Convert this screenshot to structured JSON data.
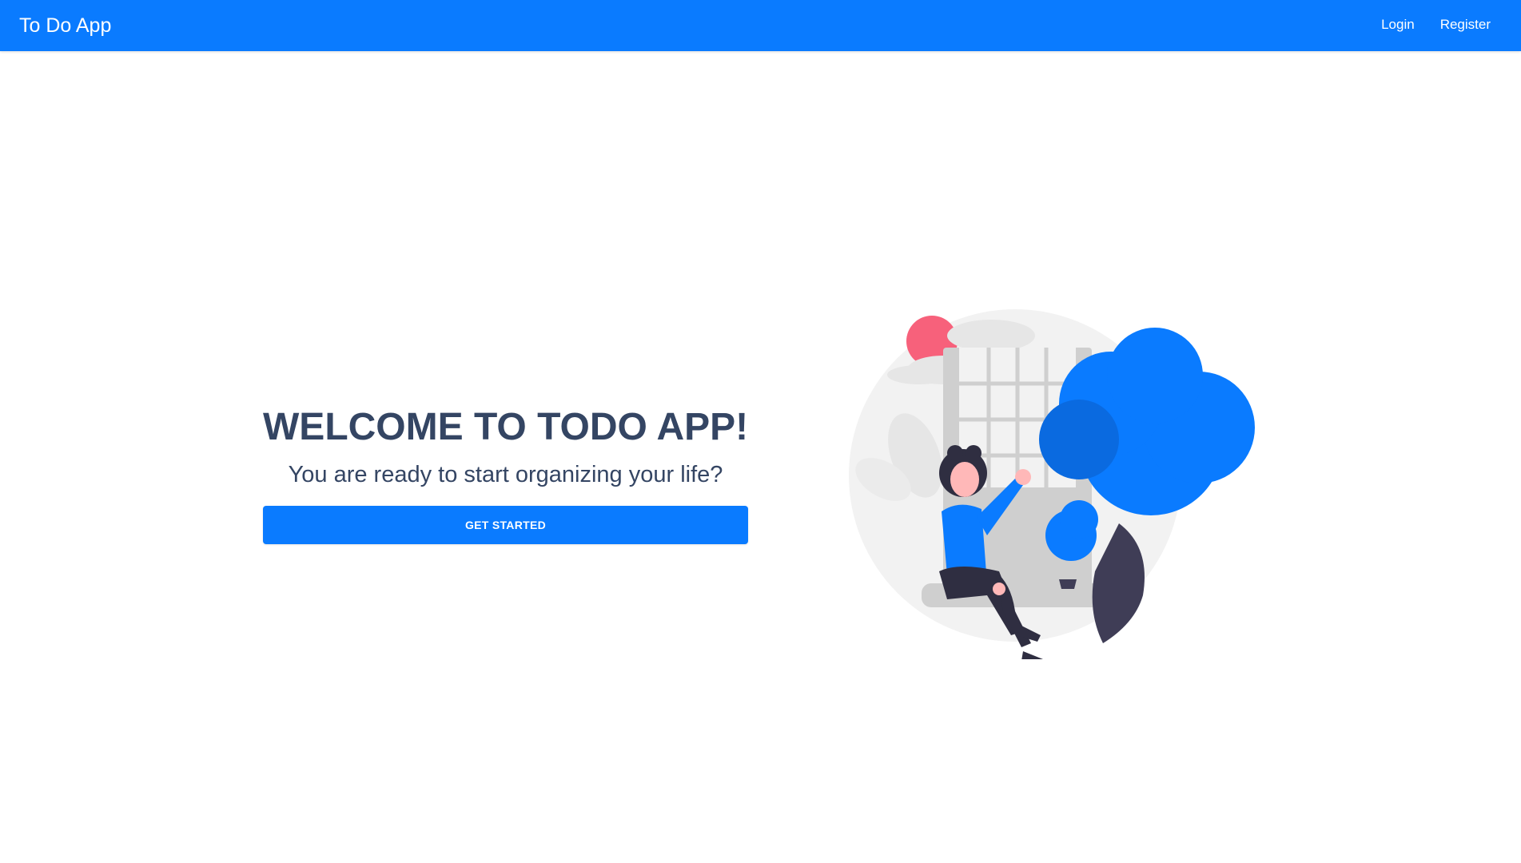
{
  "navbar": {
    "brand": "To Do App",
    "links": [
      "Login",
      "Register"
    ]
  },
  "hero": {
    "title": "WELCOME TO TODO APP!",
    "subtitle": "You are ready to start organizing your life?",
    "cta_label": "GET STARTED"
  },
  "illustration": {
    "icon": "woman-sitting-window-tree-illustration"
  },
  "colors": {
    "primary": "#0a7bff",
    "text_dark": "#344563",
    "sun": "#f7617b",
    "tree_dark": "#3f3d56",
    "background_circle": "#f2f2f2"
  }
}
